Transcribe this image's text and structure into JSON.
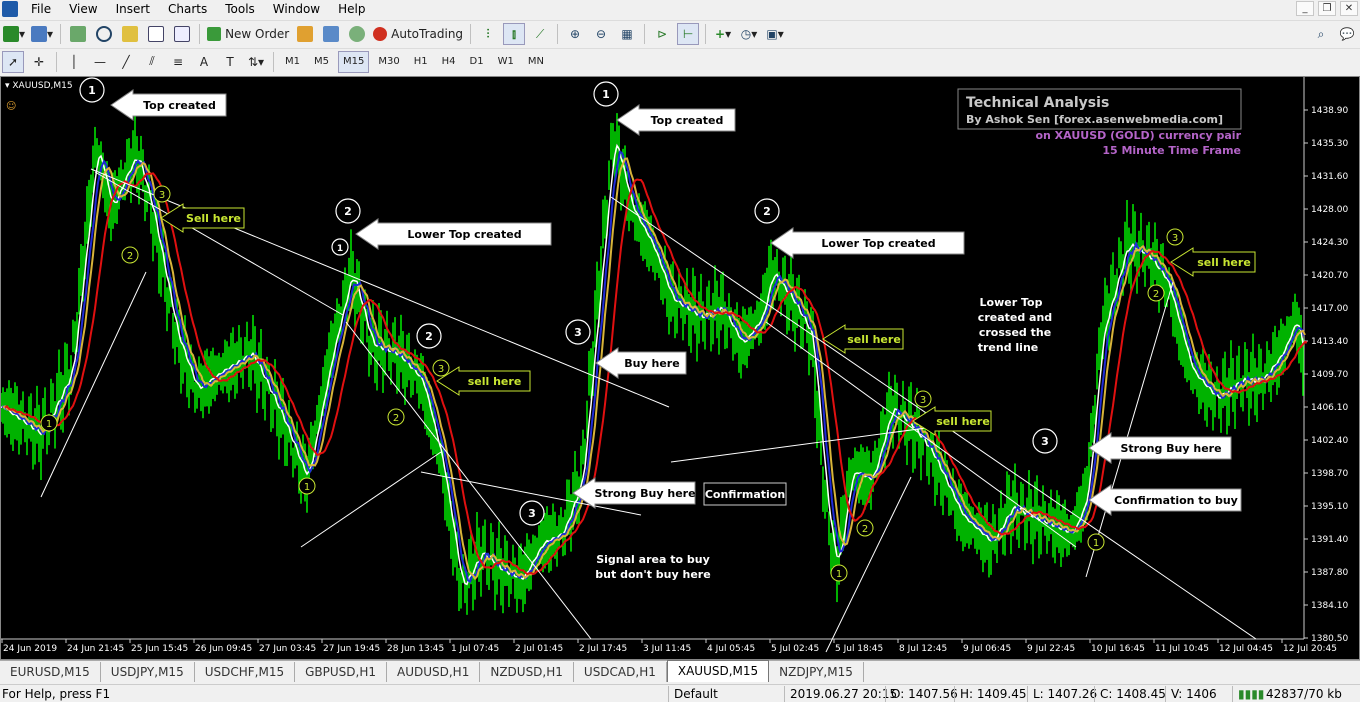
{
  "menu": [
    "File",
    "View",
    "Insert",
    "Charts",
    "Tools",
    "Window",
    "Help"
  ],
  "toolbar": {
    "new_order": "New Order",
    "autotrading": "AutoTrading"
  },
  "timeframes": [
    "M1",
    "M5",
    "M15",
    "M30",
    "H1",
    "H4",
    "D1",
    "W1",
    "MN"
  ],
  "active_timeframe": "M15",
  "chart": {
    "symbol": "XAUUSD,M15",
    "title": "Technical Analysis",
    "byline": "By Ashok Sen  [forex.asenwebmedia.com]",
    "subtitle1": "on XAUUSD (GOLD) currency pair",
    "subtitle2": "15 Minute Time Frame",
    "price_labels": [
      "1438.90",
      "1435.30",
      "1431.60",
      "1428.00",
      "1424.30",
      "1420.70",
      "1417.00",
      "1413.40",
      "1409.70",
      "1406.10",
      "1402.40",
      "1398.70",
      "1395.10",
      "1391.40",
      "1387.80",
      "1384.10",
      "1380.50"
    ],
    "time_labels": [
      "24 Jun 2019",
      "24 Jun 21:45",
      "25 Jun 15:45",
      "26 Jun 09:45",
      "27 Jun 03:45",
      "27 Jun 19:45",
      "28 Jun 13:45",
      "1 Jul 07:45",
      "2 Jul 01:45",
      "2 Jul 17:45",
      "3 Jul 11:45",
      "4 Jul 05:45",
      "5 Jul 02:45",
      "5 Jul 18:45",
      "8 Jul 12:45",
      "9 Jul 06:45",
      "9 Jul 22:45",
      "10 Jul 16:45",
      "11 Jul 10:45",
      "12 Jul 04:45",
      "12 Jul 20:45"
    ],
    "callouts": {
      "top_created_1": "Top created",
      "top_created_2": "Top created",
      "lower_top_1": "Lower Top created",
      "lower_top_2": "Lower Top created",
      "sell_here_1": "Sell here",
      "sell_here_2": "sell here",
      "sell_here_3": "sell here",
      "sell_here_4": "sell here",
      "sell_here_5": "sell here",
      "buy_here": "Buy here",
      "strong_buy_1": "Strong Buy here",
      "confirmation": "Confirmation",
      "signal_area": "Signal area to buy",
      "dont_buy": "but don't buy here",
      "lower_top_crossed_1": "Lower Top",
      "lower_top_crossed_2": "created and",
      "lower_top_crossed_3": "crossed the",
      "lower_top_crossed_4": "trend line",
      "strong_buy_2": "Strong Buy here",
      "confirmation_to_buy": "Confirmation to buy"
    },
    "markers": [
      "1",
      "2",
      "3"
    ]
  },
  "tabs": [
    "EURUSD,M15",
    "USDJPY,M15",
    "USDCHF,M15",
    "GBPUSD,H1",
    "AUDUSD,H1",
    "NZDUSD,H1",
    "USDCAD,H1",
    "XAUUSD,M15",
    "NZDJPY,M15"
  ],
  "active_tab": "XAUUSD,M15",
  "status": {
    "help": "For Help, press F1",
    "profile": "Default",
    "datetime": "2019.06.27 20:15",
    "open": "O: 1407.56",
    "high": "H: 1409.45",
    "low": "L: 1407.26",
    "close": "C: 1408.45",
    "volume": "V: 1406",
    "traffic": "42837/70 kb"
  },
  "colors": {
    "price": "#00ff00",
    "ma_fast": "#ffffff",
    "ma_blue": "#1f2bd6",
    "ma_yellow": "#d8b43a",
    "ma_red": "#e01010",
    "annot": "#c8e632",
    "title_purple": "#b464c8"
  }
}
